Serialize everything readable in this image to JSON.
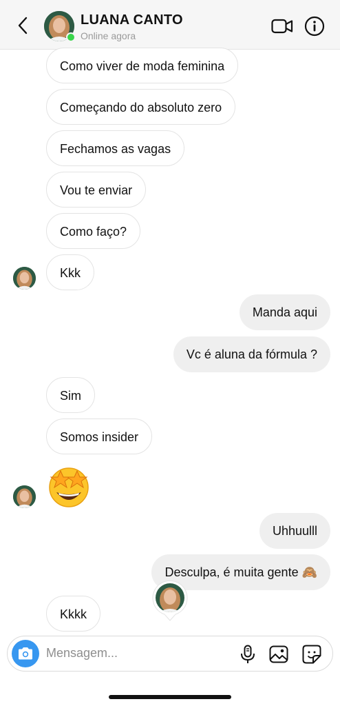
{
  "header": {
    "contact_name": "LUANA CANTO",
    "status": "Online agora",
    "icons": {
      "back": "chevron-left-icon",
      "video": "video-camera-icon",
      "info": "info-icon"
    }
  },
  "messages": [
    {
      "from": "them",
      "text": "Como viver de moda feminina"
    },
    {
      "from": "them",
      "text": "Começando do absoluto zero"
    },
    {
      "from": "them",
      "text": "Fechamos as vagas"
    },
    {
      "from": "them",
      "text": "Vou te enviar"
    },
    {
      "from": "them",
      "text": "Como faço?"
    },
    {
      "from": "them",
      "text": "Kkk"
    },
    {
      "from": "me",
      "text": "Manda aqui"
    },
    {
      "from": "me",
      "text": "Vc é aluna da fórmula ?"
    },
    {
      "from": "them",
      "text": "Sim"
    },
    {
      "from": "them",
      "text": "Somos insider"
    },
    {
      "from": "them",
      "emoji": "star-struck",
      "text": "🤩"
    },
    {
      "from": "me",
      "text": "Uhhuulll"
    },
    {
      "from": "me",
      "text": "Desculpa, é muita gente 🙈"
    },
    {
      "from": "them",
      "text": "Kkkk"
    }
  ],
  "composer": {
    "placeholder": "Mensagem...",
    "icons": {
      "camera": "camera-icon",
      "mic": "microphone-icon",
      "gallery": "image-icon",
      "sticker": "sticker-icon"
    }
  },
  "colors": {
    "accent": "#3797f0",
    "online": "#38d54a",
    "outgoing_bubble": "#efefef",
    "incoming_border": "#e3e3e3"
  }
}
